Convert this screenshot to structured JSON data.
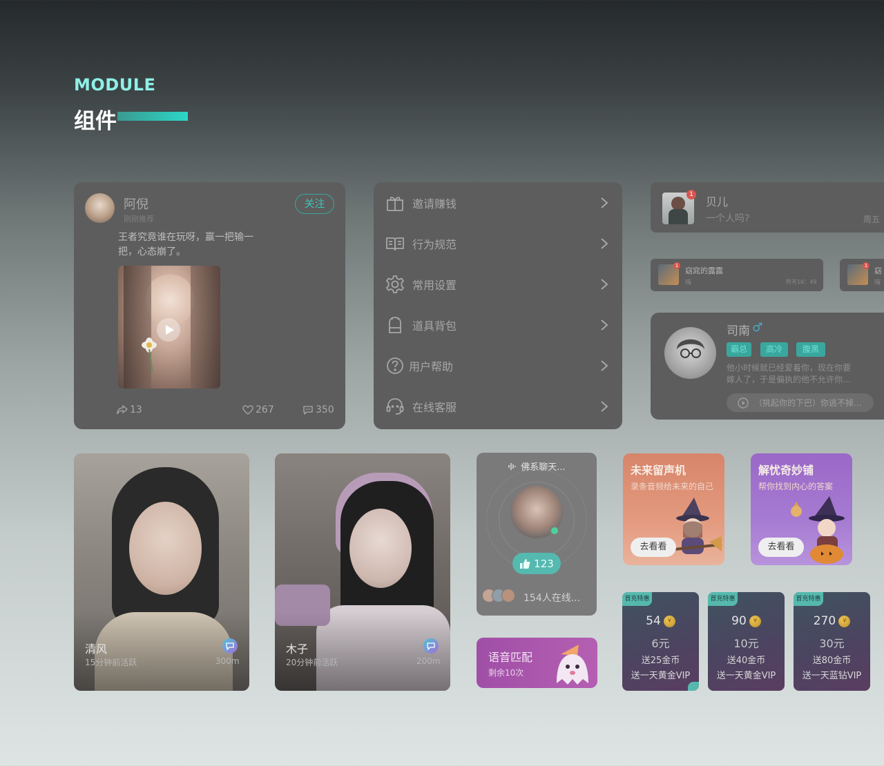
{
  "header": {
    "eyebrow": "MODULE",
    "title": "组件"
  },
  "feed_card": {
    "user_name": "阿倪",
    "user_subtitle": "刚刚推荐",
    "follow_label": "关注",
    "post_text_line1": "王者究竟谁在玩呀，赢一把输一",
    "post_text_line2": "把，心态崩了。",
    "share_count": "13",
    "like_count": "267",
    "comment_count": "350"
  },
  "menu": {
    "items": [
      {
        "label": "邀请赚钱",
        "icon": "gift-icon"
      },
      {
        "label": "行为规范",
        "icon": "book-icon"
      },
      {
        "label": "常用设置",
        "icon": "gear-icon"
      },
      {
        "label": "道具背包",
        "icon": "backpack-icon"
      },
      {
        "label": "用户帮助",
        "icon": "help-icon"
      },
      {
        "label": "在线客服",
        "icon": "headset-icon"
      }
    ]
  },
  "notifications": {
    "main": {
      "name": "贝儿",
      "message": "一个人吗?",
      "time": "周五",
      "badge": "1"
    },
    "small": [
      {
        "name": "窈窕的露露",
        "message": "嗨",
        "time": "昨天16：49",
        "badge": "1"
      },
      {
        "name": "窈",
        "message": "嗨",
        "badge": "1"
      }
    ]
  },
  "profile_card": {
    "name": "司南",
    "gender_icon": "♂",
    "tags": [
      "霸总",
      "高冷",
      "腹黑"
    ],
    "bio_line1": "他小时候就已经爱着你，现在你要",
    "bio_line2": "嫁人了，于是偏执的他不允许你…",
    "voice_text": "（挑起你的下巴）你逃不掉…"
  },
  "photo_cards": [
    {
      "name": "清风",
      "status": "15分钟前活跃",
      "distance": "300m"
    },
    {
      "name": "木子",
      "status": "20分钟前活跃",
      "distance": "200m"
    }
  ],
  "voice_chat": {
    "title": "佛系聊天...",
    "likes": "123",
    "online": "154人在线..."
  },
  "voice_match": {
    "title": "语音匹配",
    "subtitle": "剩余10次"
  },
  "promos": [
    {
      "title": "未来留声机",
      "subtitle": "录条音频给未来的自己",
      "button": "去看看"
    },
    {
      "title": "解忧奇妙铺",
      "subtitle": "帮你找到内心的答案",
      "button": "去看看"
    }
  ],
  "offers": [
    {
      "tag": "首充特惠",
      "coins": "54",
      "price": "6元",
      "bonus": "送25金币",
      "vip": "送一天黄金VIP"
    },
    {
      "tag": "首充特惠",
      "coins": "90",
      "price": "10元",
      "bonus": "送40金币",
      "vip": "送一天黄金VIP"
    },
    {
      "tag": "首充特惠",
      "coins": "270",
      "price": "30元",
      "bonus": "送80金币",
      "vip": "送一天蓝钻VIP"
    }
  ],
  "colors": {
    "accent": "#2cd8c8",
    "card": "#5d5d5d",
    "tag": "#3aa79e"
  }
}
